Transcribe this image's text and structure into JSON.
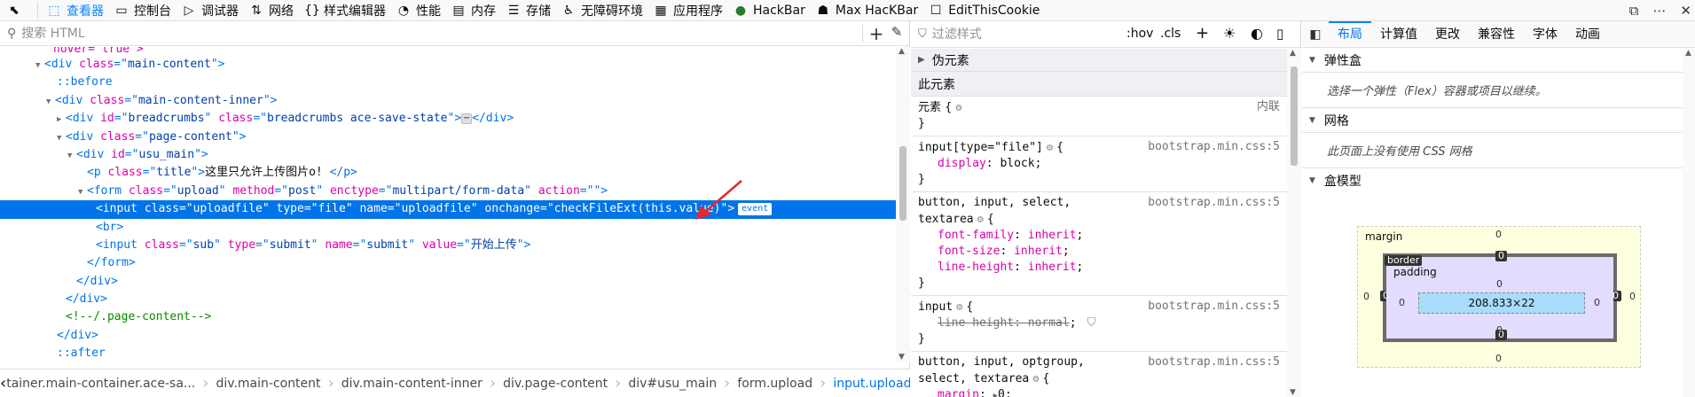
{
  "toolbar": {
    "tabs": [
      {
        "label": "查看器",
        "icon": "inspector-icon",
        "glyph": "⬚"
      },
      {
        "label": "控制台",
        "icon": "console-icon",
        "glyph": "▭"
      },
      {
        "label": "调试器",
        "icon": "debugger-icon",
        "glyph": "▷"
      },
      {
        "label": "网络",
        "icon": "network-icon",
        "glyph": "⇅"
      },
      {
        "label": "样式编辑器",
        "icon": "style-editor-icon",
        "glyph": "{}"
      },
      {
        "label": "性能",
        "icon": "performance-icon",
        "glyph": "◔"
      },
      {
        "label": "内存",
        "icon": "memory-icon",
        "glyph": "▤"
      },
      {
        "label": "存储",
        "icon": "storage-icon",
        "glyph": "▦"
      },
      {
        "label": "无障碍环境",
        "icon": "accessibility-icon",
        "glyph": "♿"
      },
      {
        "label": "应用程序",
        "icon": "application-icon",
        "glyph": "▦"
      },
      {
        "label": "HackBar",
        "icon": "hackbar-icon",
        "glyph": "●"
      },
      {
        "label": "Max HacKBar",
        "icon": "max-hackbar-icon",
        "glyph": "☗"
      },
      {
        "label": "EditThisCookie",
        "icon": "editthiscookie-icon",
        "glyph": "☐"
      }
    ]
  },
  "search": {
    "placeholder": "搜索 HTML"
  },
  "markup": {
    "line0_tail": "hover=\"true\">",
    "main_content_class": "main-content",
    "before": "::before",
    "inner_class": "main-content-inner",
    "breadcrumbs_id": "breadcrumbs",
    "breadcrumbs_class": "breadcrumbs ace-save-state",
    "page_content_class": "page-content",
    "usu_main_id": "usu_main",
    "title_class": "title",
    "title_text": "这里只允许上传图片o! ",
    "form_class": "upload",
    "form_method": "post",
    "form_enctype": "multipart/form-data",
    "form_action": "",
    "input_class": "uploadfile",
    "input_type": "file",
    "input_name": "uploadfile",
    "input_onchange": "checkFileExt(this.value)",
    "event_badge": "event",
    "submit_class": "sub",
    "submit_type": "submit",
    "submit_name": "submit",
    "submit_value": "开始上传",
    "comment": "<!--/.page-content-->",
    "after": "::after"
  },
  "breadcrumbs": [
    "tainer.main-container.ace-sa...",
    "div.main-content",
    "div.main-content-inner",
    "div.page-content",
    "div#usu_main",
    "form.upload",
    "input.uploadfile"
  ],
  "rules": {
    "filter_placeholder": "过滤样式",
    "hov": ":hov",
    "cls": ".cls",
    "pseudo_label": "伪元素",
    "this_element": "此元素",
    "element_rule": {
      "selector": "元素 {",
      "source": "内联"
    },
    "r1": {
      "selector": "input[type=\"file\"]",
      "source": "bootstrap.min.css:5",
      "decls": [
        {
          "p": "display",
          "v": "block"
        }
      ]
    },
    "r2": {
      "selector1": "button, input, select,",
      "selector2": "textarea",
      "source": "bootstrap.min.css:5",
      "decls": [
        {
          "p": "font-family",
          "v": "inherit"
        },
        {
          "p": "font-size",
          "v": "inherit"
        },
        {
          "p": "line-height",
          "v": "inherit"
        }
      ]
    },
    "r3": {
      "selector": "input",
      "source": "bootstrap.min.css:5",
      "decls": [
        {
          "p": "line-height",
          "v": "normal"
        }
      ]
    },
    "r4": {
      "selector1": "button, input, optgroup,",
      "selector2": "select, textarea",
      "source": "bootstrap.min.css:5",
      "decls": [
        {
          "p": "margin",
          "v": "0"
        }
      ]
    }
  },
  "layout": {
    "tabs": [
      "布局",
      "计算值",
      "更改",
      "兼容性",
      "字体",
      "动画"
    ],
    "flex_title": "弹性盒",
    "flex_msg": "选择一个弹性（Flex）容器或项目以继续。",
    "grid_title": "网格",
    "grid_msg": "此页面上没有使用 CSS 网格",
    "boxmodel_title": "盒模型",
    "box": {
      "margin_label": "margin",
      "border_label": "border",
      "padding_label": "padding",
      "content": "208.833×22",
      "margin": {
        "top": "0",
        "right": "0",
        "bottom": "0",
        "left": "0"
      },
      "border": {
        "top": "0",
        "right": "0",
        "bottom": "0",
        "left": "0"
      },
      "padding": {
        "top": "0",
        "right": "0",
        "bottom": "0",
        "left": "0"
      }
    }
  }
}
